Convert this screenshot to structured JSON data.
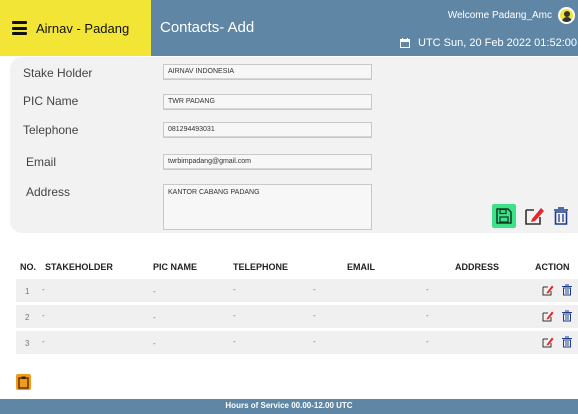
{
  "header": {
    "brand": "Airnav - Padang",
    "title": "Contacts- Add",
    "welcome": "Welcome Padang_Amc",
    "datetime": "UTC Sun, 20 Feb 2022 01:52:00"
  },
  "form": {
    "stakeholder": {
      "label": "Stake Holder",
      "value": "AIRNAV INDONESIA"
    },
    "pic_name": {
      "label": "PIC Name",
      "value": "TWR PADANG"
    },
    "telephone": {
      "label": "Telephone",
      "value": "081294493031"
    },
    "email": {
      "label": "Email",
      "value": "twrbimpadang@gmail.com"
    },
    "address": {
      "label": "Address",
      "value": "KANTOR CABANG PADANG"
    }
  },
  "colors": {
    "header": "#5f87a5",
    "brand": "#f2e535",
    "save": "#3ee08a",
    "edit": "#e2262a",
    "bottom_button": "#f29b1b"
  },
  "table": {
    "columns": [
      "NO.",
      "STAKEHOLDER",
      "PIC NAME",
      "TELEPHONE",
      "EMAIL",
      "ADDRESS",
      "ACTION"
    ],
    "rows": [
      {
        "no": "1",
        "stakeholder": "-",
        "pic_name": "-",
        "telephone": "-",
        "email": "-",
        "address": "-"
      },
      {
        "no": "2",
        "stakeholder": "-",
        "pic_name": "-",
        "telephone": "-",
        "email": "-",
        "address": "-"
      },
      {
        "no": "3",
        "stakeholder": "-",
        "pic_name": "-",
        "telephone": "-",
        "email": "-",
        "address": "-"
      }
    ]
  },
  "footer": {
    "text": "Hours of Service 00.00-12.00 UTC"
  }
}
